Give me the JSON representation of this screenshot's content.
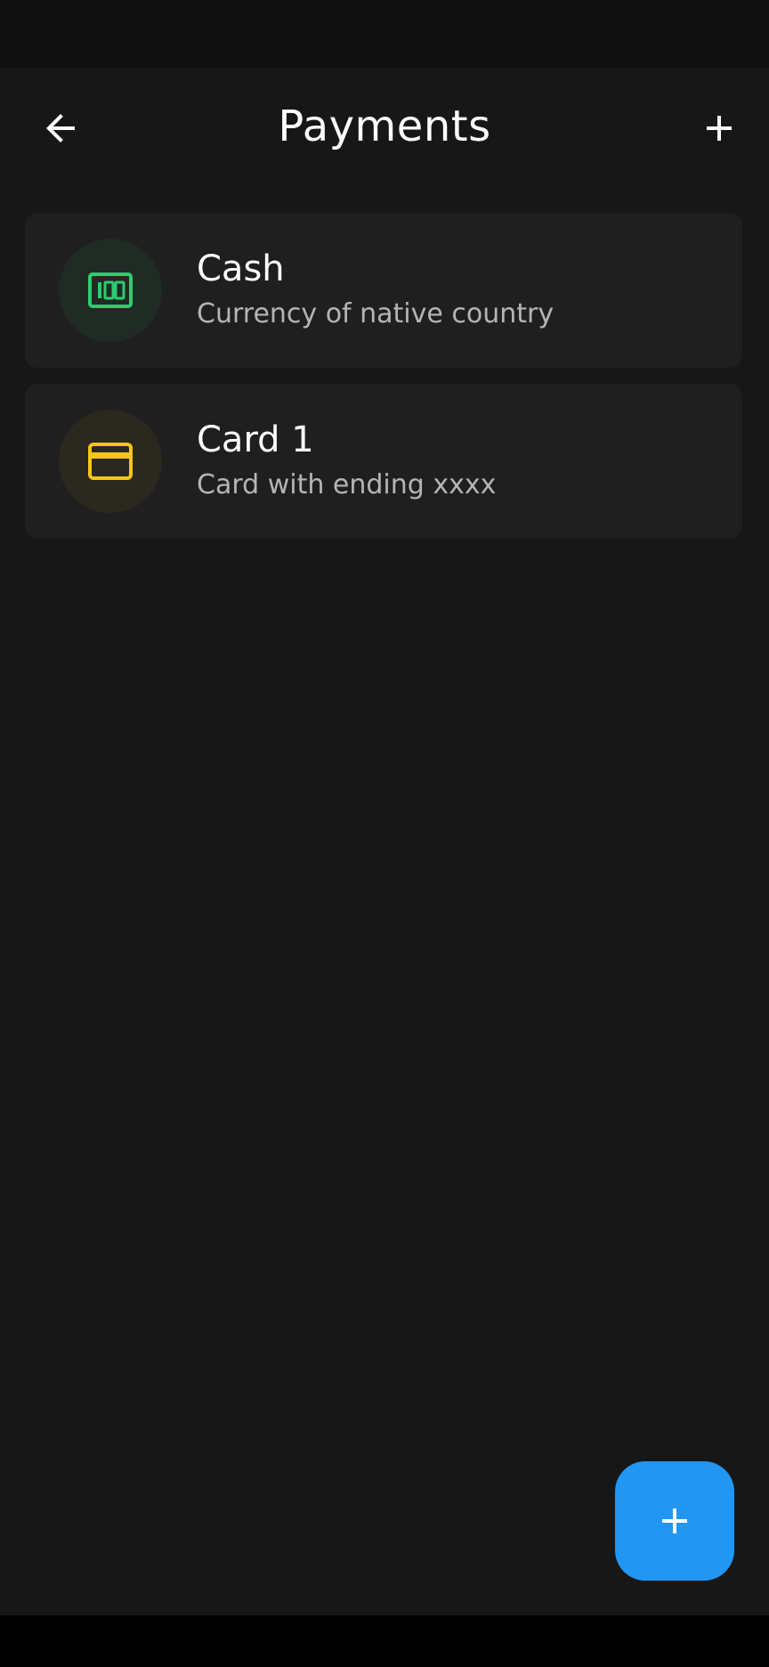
{
  "header": {
    "title": "Payments",
    "back_icon": "arrow-left-icon",
    "add_icon": "plus-icon"
  },
  "payments": [
    {
      "name": "Cash",
      "description": "Currency of native country",
      "icon": "cash-icon",
      "icon_color": "#2ecc71",
      "avatar_bg": "#1f2b24"
    },
    {
      "name": "Card 1",
      "description": "Card with ending xxxx",
      "icon": "credit-card-icon",
      "icon_color": "#f5c518",
      "avatar_bg": "#2b2820"
    }
  ],
  "fab": {
    "icon": "plus-icon",
    "color": "#2196f3"
  }
}
